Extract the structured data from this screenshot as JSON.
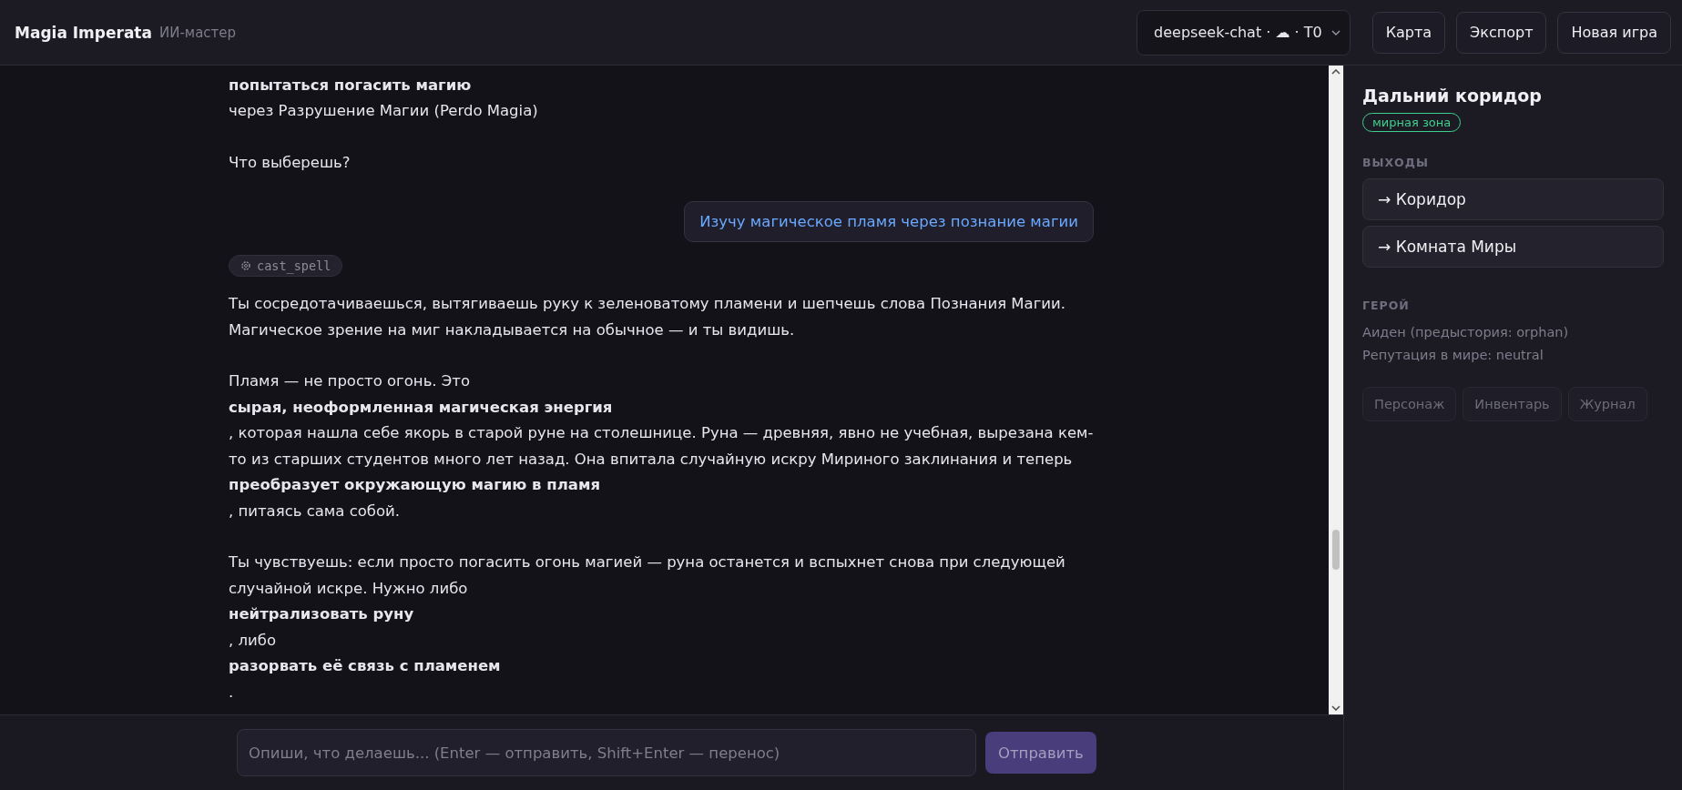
{
  "header": {
    "title": "Magia Imperata",
    "subtitle": "ИИ-мастер",
    "model_select": {
      "value": "deepseek-chat · ☁ · T0"
    },
    "buttons": [
      "Карта",
      "Экспорт",
      "Новая игра"
    ]
  },
  "messages": [
    {
      "kind": "assistant",
      "paragraphs": [
        [
          {
            "text": "попытаться погасить магию",
            "bold": true
          },
          {
            "text": "через Разрушение Магии (Perdo Magia)",
            "bold": false
          }
        ],
        [
          {
            "text": "Что выберешь?",
            "bold": false
          }
        ]
      ]
    },
    {
      "kind": "user",
      "text": "Изучу магическое пламя через познание магии"
    },
    {
      "kind": "tool",
      "text": "cast_spell"
    },
    {
      "kind": "assistant",
      "paragraphs": [
        [
          {
            "text": "Ты сосредотачиваешься, вытягиваешь руку к зеленоватому пламени и шепчешь слова Познания Магии. Магическое зрение на миг накладывается на обычное — и ты видишь.",
            "bold": false
          }
        ],
        [
          {
            "text": "Пламя — не просто огонь. Это",
            "bold": false
          },
          {
            "text": "сырая, неоформленная магическая энергия",
            "bold": true
          },
          {
            "text": ", которая нашла себе якорь в старой руне на столешнице. Руна — древняя, явно не учебная, вырезана кем-то из старших студентов много лет назад. Она впитала случайную искру Мириного заклинания и теперь",
            "bold": false
          },
          {
            "text": "преобразует окружающую магию в пламя",
            "bold": true
          },
          {
            "text": ", питаясь сама собой.",
            "bold": false
          }
        ],
        [
          {
            "text": "Ты чувствуешь: если просто погасить огонь магией — руна останется и вспыхнет снова при следующей случайной искре. Нужно либо",
            "bold": false
          },
          {
            "text": "нейтрализовать руну",
            "bold": true
          },
          {
            "text": ", либо",
            "bold": false
          },
          {
            "text": "разорвать её связь с пламенем",
            "bold": true
          },
          {
            "text": ".",
            "bold": false
          }
        ]
      ]
    }
  ],
  "composer": {
    "placeholder": "Опиши, что делаешь... (Enter — отправить, Shift+Enter — перенос)",
    "send_button": {
      "label": "Отправить",
      "disabled": true
    }
  },
  "sidebar": {
    "location": "Дальний коридор",
    "zone_tag": {
      "label": "мирная зона",
      "color": "#3ecf8e"
    },
    "exits_heading": "ВЫХОДЫ",
    "exits": [
      "→ Коридор",
      "→ Комната Миры"
    ],
    "hero_heading": "ГЕРОЙ",
    "hero_lines": [
      "Аиден (предыстория: orphan)",
      "Репутация в мире: neutral"
    ],
    "tabs": [
      {
        "label": "Персонаж",
        "selected": false
      },
      {
        "label": "Инвентарь",
        "selected": false
      },
      {
        "label": "Журнал",
        "selected": false
      }
    ]
  }
}
